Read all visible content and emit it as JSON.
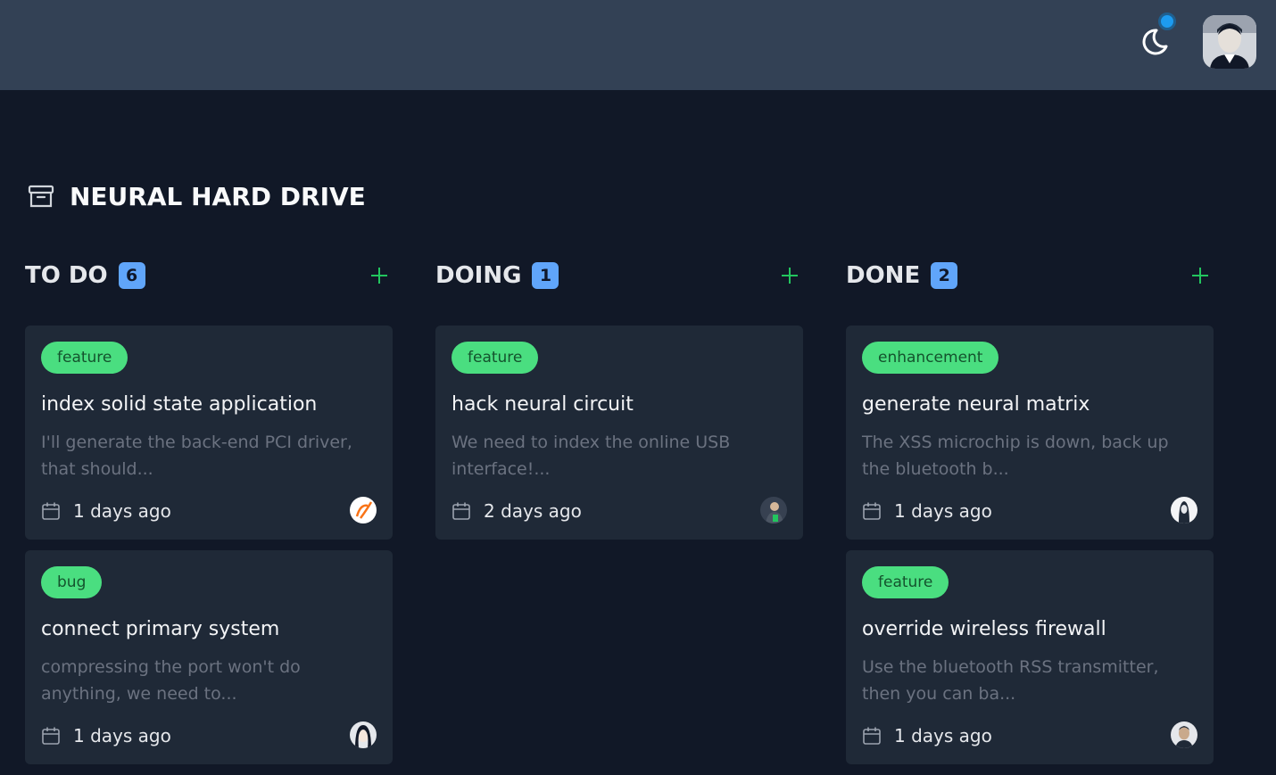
{
  "topbar": {
    "theme_toggle_icon": "moon-icon",
    "notification_dot_color": "#1d9bf0",
    "user_avatar_icon": "user-avatar"
  },
  "board": {
    "icon": "archive-icon",
    "title": "NEURAL HARD DRIVE"
  },
  "columns": [
    {
      "title": "TO DO",
      "count": "6",
      "add_icon": "plus-icon",
      "cards": [
        {
          "tag": "feature",
          "title": "index solid state application",
          "desc": "I'll generate the back-end PCI driver, that should...",
          "date": "1 days ago"
        },
        {
          "tag": "bug",
          "title": "connect primary system",
          "desc": "compressing the port won't do anything, we need to...",
          "date": "1 days ago"
        }
      ]
    },
    {
      "title": "DOING",
      "count": "1",
      "add_icon": "plus-icon",
      "cards": [
        {
          "tag": "feature",
          "title": "hack neural circuit",
          "desc": "We need to index the online USB interface!...",
          "date": "2 days ago"
        }
      ]
    },
    {
      "title": "DONE",
      "count": "2",
      "add_icon": "plus-icon",
      "cards": [
        {
          "tag": "enhancement",
          "title": "generate neural matrix",
          "desc": "The XSS microchip is down, back up the bluetooth b...",
          "date": "1 days ago"
        },
        {
          "tag": "feature",
          "title": "override wireless firewall",
          "desc": "Use the bluetooth RSS transmitter, then you can ba...",
          "date": "1 days ago"
        }
      ]
    }
  ],
  "colors": {
    "background": "#111827",
    "topbar": "#334155",
    "card": "#1f2937",
    "tag": "#4ade80",
    "count_badge": "#60a5fa",
    "add_icon": "#22c55e"
  }
}
